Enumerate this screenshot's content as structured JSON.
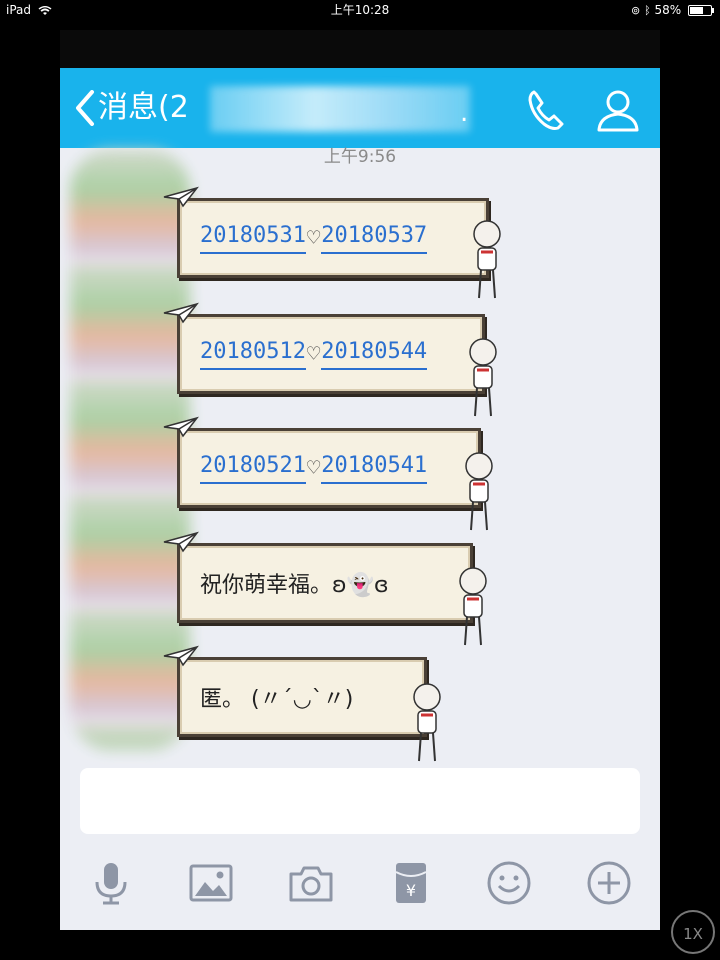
{
  "status_bar": {
    "device": "iPad",
    "time": "上午10:28",
    "battery": "58%"
  },
  "header": {
    "back_label": "消息(2",
    "trailing": "."
  },
  "chat": {
    "timestamp": "上午9:56",
    "messages": [
      {
        "left": "20180531",
        "heart": "♡",
        "right": "20180537"
      },
      {
        "left": "20180512",
        "heart": "♡",
        "right": "20180544"
      },
      {
        "left": "20180521",
        "heart": "♡",
        "right": "20180541"
      },
      {
        "text": "祝你萌幸福。ʚ👻ɞ"
      },
      {
        "text": "匿。 (〃´◡`〃)"
      }
    ]
  },
  "input": {
    "placeholder": ""
  },
  "toolbar": {
    "icons": [
      "microphone-icon",
      "image-icon",
      "camera-icon",
      "red-packet-icon",
      "emoji-icon",
      "plus-icon"
    ],
    "red_packet_symbol": "¥"
  },
  "zoom": "1X",
  "colors": {
    "nav": "#19b3ec",
    "link": "#2a6fcf",
    "bg": "#eceef4"
  }
}
